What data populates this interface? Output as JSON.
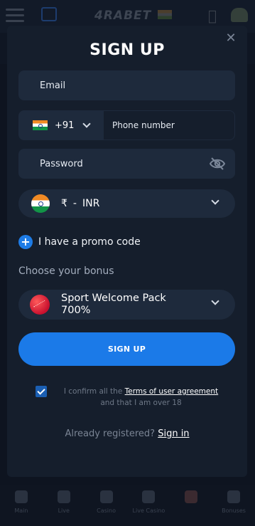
{
  "background": {
    "logo": "4RABET",
    "nav": [
      {
        "label": "Main"
      },
      {
        "label": "Live"
      },
      {
        "label": "Casino"
      },
      {
        "label": "Live Casino"
      },
      {
        "label": ""
      },
      {
        "label": "Bonuses"
      }
    ]
  },
  "modal": {
    "title": "SIGN UP",
    "close_icon": "close-icon",
    "email_placeholder": "Email",
    "phone": {
      "dial_code": "+91",
      "placeholder": "Phone number"
    },
    "password_placeholder": "Password",
    "currency": {
      "symbol": "₹",
      "separator": "-",
      "code": "INR"
    },
    "promo_label": "I have a promo code",
    "choose_bonus_label": "Choose your bonus",
    "bonus": {
      "name": "Sport Welcome Pack 700%"
    },
    "signup_button": "SIGN UP",
    "confirm": {
      "prefix": "I confirm all the",
      "terms_link": "Terms of user agreement",
      "suffix": "and that I am over 18",
      "checked": true
    },
    "already": {
      "text": "Already registered?",
      "link": "Sign in"
    },
    "accent_color": "#1b7ae8"
  }
}
